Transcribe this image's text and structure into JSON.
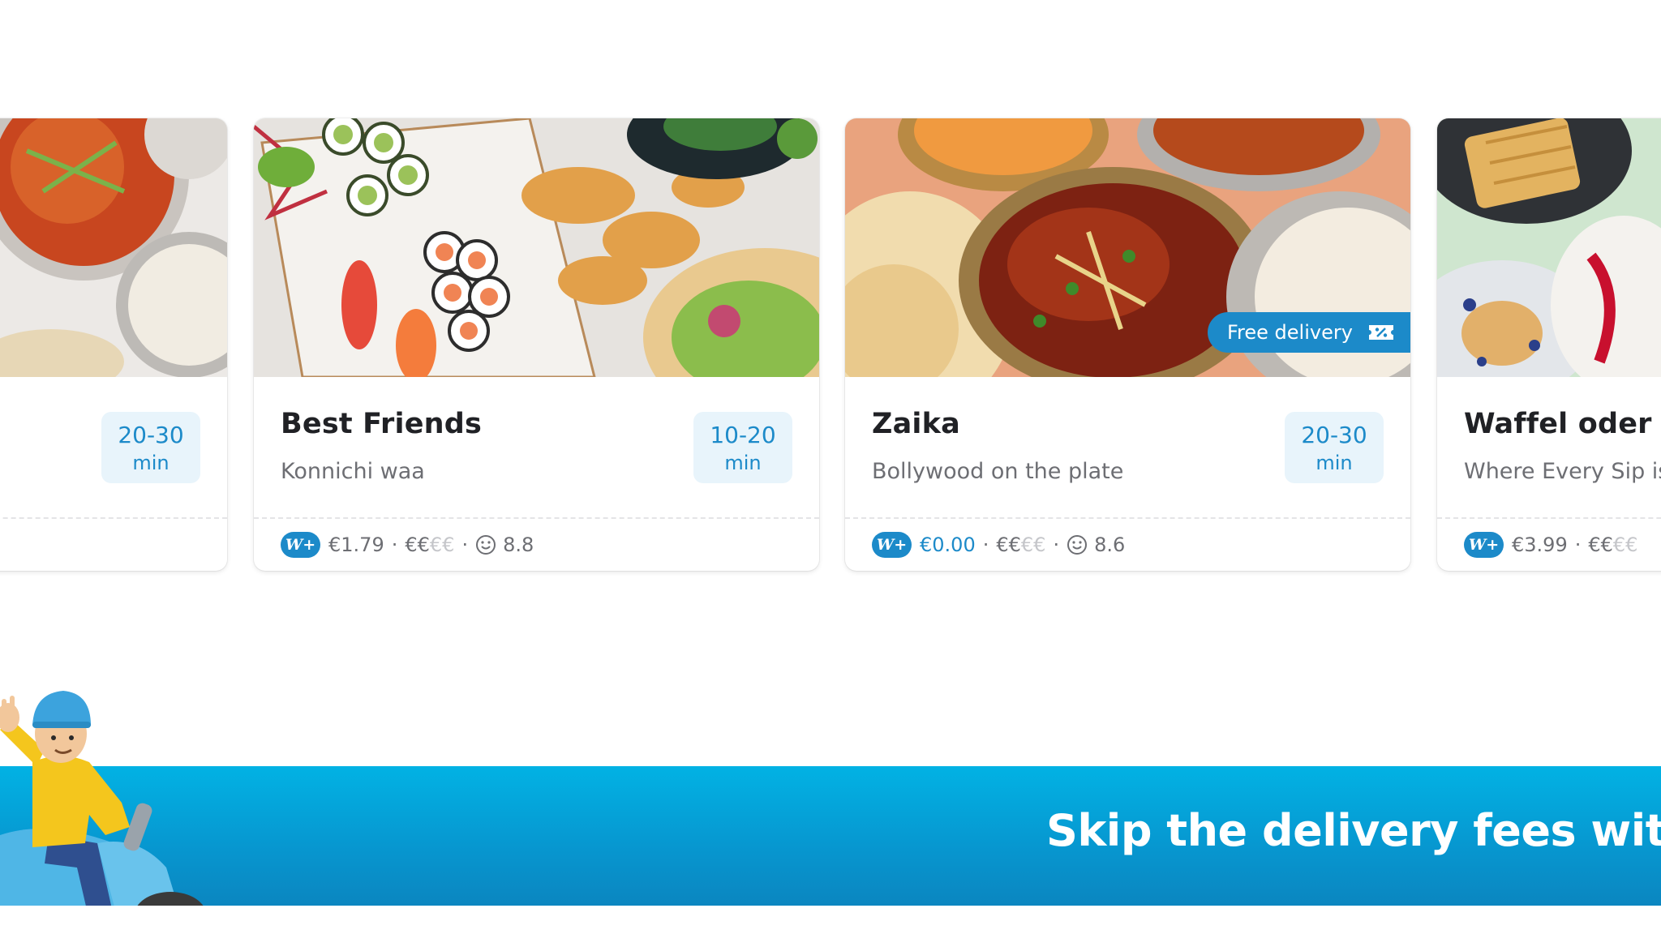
{
  "venues": [
    {
      "name": "",
      "tagline": "",
      "eta_range": "20-30",
      "eta_unit": "min",
      "delivery_fee": "",
      "price_level_on": "",
      "price_level_off": "",
      "rating": ""
    },
    {
      "name": "Best Friends",
      "tagline": "Konnichi waa",
      "eta_range": "10-20",
      "eta_unit": "min",
      "badge": "W+",
      "delivery_fee": "€1.79",
      "price_level_on": "€€",
      "price_level_off": "€€",
      "rating": "8.8"
    },
    {
      "name": "Zaika",
      "tagline": "Bollywood on the plate",
      "eta_range": "20-30",
      "eta_unit": "min",
      "badge": "W+",
      "delivery_fee": "€0.00",
      "price_level_on": "€€",
      "price_level_off": "€€",
      "rating": "8.6",
      "promo_label": "Free delivery"
    },
    {
      "name": "Waffel oder Be",
      "tagline": "Where Every Sip is",
      "badge": "W+",
      "delivery_fee": "€3.99",
      "price_level_on": "€€",
      "price_level_off": "€€"
    }
  ],
  "separator": "·",
  "banner": {
    "text": "Skip the delivery fees with Wo"
  },
  "colors": {
    "accent": "#1c8ac9",
    "eta_background": "#e8f4fb",
    "banner": "#0796cf"
  },
  "icons": [
    "wolt-plus-badge-icon",
    "smiley-rating-icon",
    "ticket-percent-icon"
  ]
}
